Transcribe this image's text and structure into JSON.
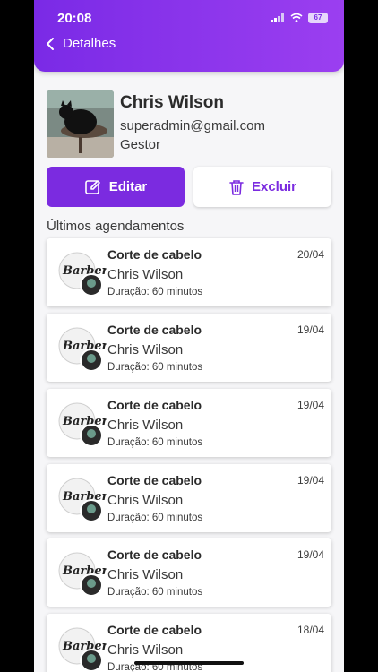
{
  "status": {
    "time": "20:08",
    "battery": "67"
  },
  "header": {
    "title": "Detalhes"
  },
  "profile": {
    "name": "Chris Wilson",
    "email": "superadmin@gmail.com",
    "role": "Gestor"
  },
  "actions": {
    "edit_label": "Editar",
    "delete_label": "Excluir"
  },
  "section_title": "Últimos agendamentos",
  "appointments": [
    {
      "title": "Corte de cabelo",
      "client": "Chris Wilson",
      "duration": "Duração: 60 minutos",
      "date": "20/04"
    },
    {
      "title": "Corte de cabelo",
      "client": "Chris Wilson",
      "duration": "Duração: 60 minutos",
      "date": "19/04"
    },
    {
      "title": "Corte de cabelo",
      "client": "Chris Wilson",
      "duration": "Duração: 60 minutos",
      "date": "19/04"
    },
    {
      "title": "Corte de cabelo",
      "client": "Chris Wilson",
      "duration": "Duração: 60 minutos",
      "date": "19/04"
    },
    {
      "title": "Corte de cabelo",
      "client": "Chris Wilson",
      "duration": "Duração: 60 minutos",
      "date": "19/04"
    },
    {
      "title": "Corte de cabelo",
      "client": "Chris Wilson",
      "duration": "Duração: 60 minutos",
      "date": "18/04"
    }
  ],
  "icons": {
    "back": "chevron-left-icon",
    "edit": "edit-icon",
    "delete": "trash-icon",
    "logo": "barber-logo-icon"
  },
  "colors": {
    "primary": "#7b2be0",
    "header_start": "#7a2ae6",
    "header_end": "#9b3ff0"
  }
}
